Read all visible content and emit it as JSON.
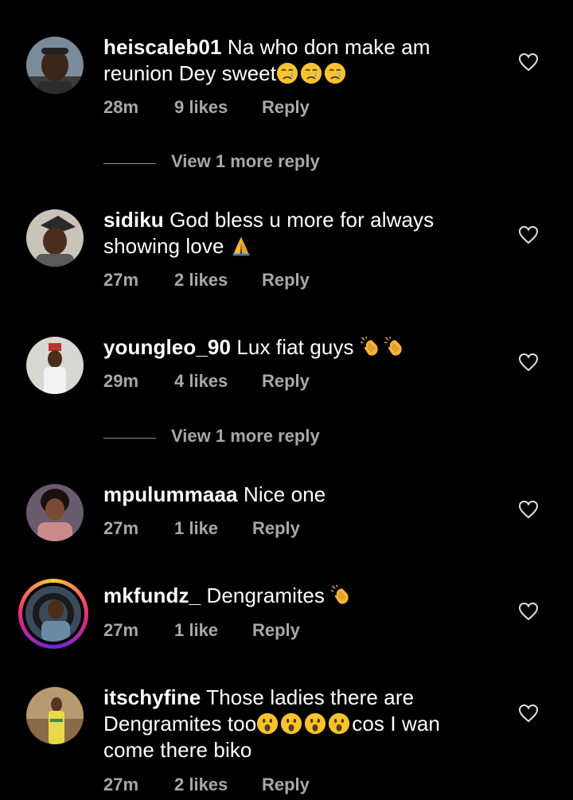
{
  "comments": [
    {
      "username": "heiscaleb01",
      "text": "Na who don make am reunion Dey sweet",
      "emojis": [
        "crying-face",
        "crying-face",
        "crying-face"
      ],
      "time": "28m",
      "likes": "9 likes",
      "reply": "Reply",
      "view_more": "View 1 more reply"
    },
    {
      "username": "sidiku",
      "text": "God bless u more for always showing love",
      "emojis": [
        "folded-hands"
      ],
      "time": "27m",
      "likes": "2 likes",
      "reply": "Reply"
    },
    {
      "username": "youngleo_90",
      "text": "Lux fiat guys",
      "emojis": [
        "clapping-hands",
        "clapping-hands"
      ],
      "time": "29m",
      "likes": "4 likes",
      "reply": "Reply",
      "view_more": "View 1 more reply"
    },
    {
      "username": "mpulummaaa",
      "text": "Nice one",
      "emojis": [],
      "time": "27m",
      "likes": "1 like",
      "reply": "Reply"
    },
    {
      "username": "mkfundz_",
      "text": "Dengramites",
      "emojis": [
        "clapping-hands"
      ],
      "time": "27m",
      "likes": "1 like",
      "reply": "Reply"
    },
    {
      "username": "itschyfine",
      "text_before": "Those ladies there are Dengramites too",
      "emojis": [
        "astonished-face",
        "astonished-face",
        "astonished-face",
        "astonished-face"
      ],
      "text_after": "cos I wan come there biko",
      "time": "27m",
      "likes": "2 likes",
      "reply": "Reply"
    }
  ]
}
